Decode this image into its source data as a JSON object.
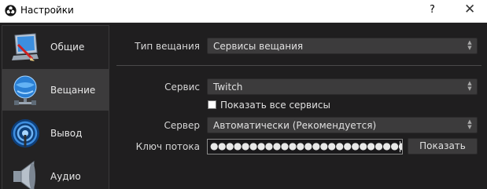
{
  "window": {
    "title": "Настройки",
    "help_glyph": "?",
    "close_glyph": "✕"
  },
  "sidebar": {
    "items": [
      {
        "label": "Общие",
        "icon": "monitor-icon",
        "active": false
      },
      {
        "label": "Вещание",
        "icon": "globe-network-icon",
        "active": true
      },
      {
        "label": "Вывод",
        "icon": "broadcast-antenna-icon",
        "active": false
      },
      {
        "label": "Аудио",
        "icon": "speaker-icon",
        "active": false
      }
    ]
  },
  "form": {
    "stream_type": {
      "label": "Тип вещания",
      "value": "Сервисы вещания"
    },
    "service": {
      "label": "Сервис",
      "value": "Twitch"
    },
    "show_all": {
      "label": "Показать все сервисы",
      "checked": false
    },
    "server": {
      "label": "Сервер",
      "value": "Автоматически (Рекомендуется)"
    },
    "stream_key": {
      "label": "Ключ потока",
      "masked_value": "●●●●●●●●●●●●●●●●●●●●●●●●●●●●●●●●●●●●●●●●"
    },
    "show_button": "Показать"
  },
  "colors": {
    "background": "#1f1e1f",
    "panel": "#3c3b3c",
    "text": "#d8d8d8",
    "accent_blue": "#2a7fd4"
  }
}
